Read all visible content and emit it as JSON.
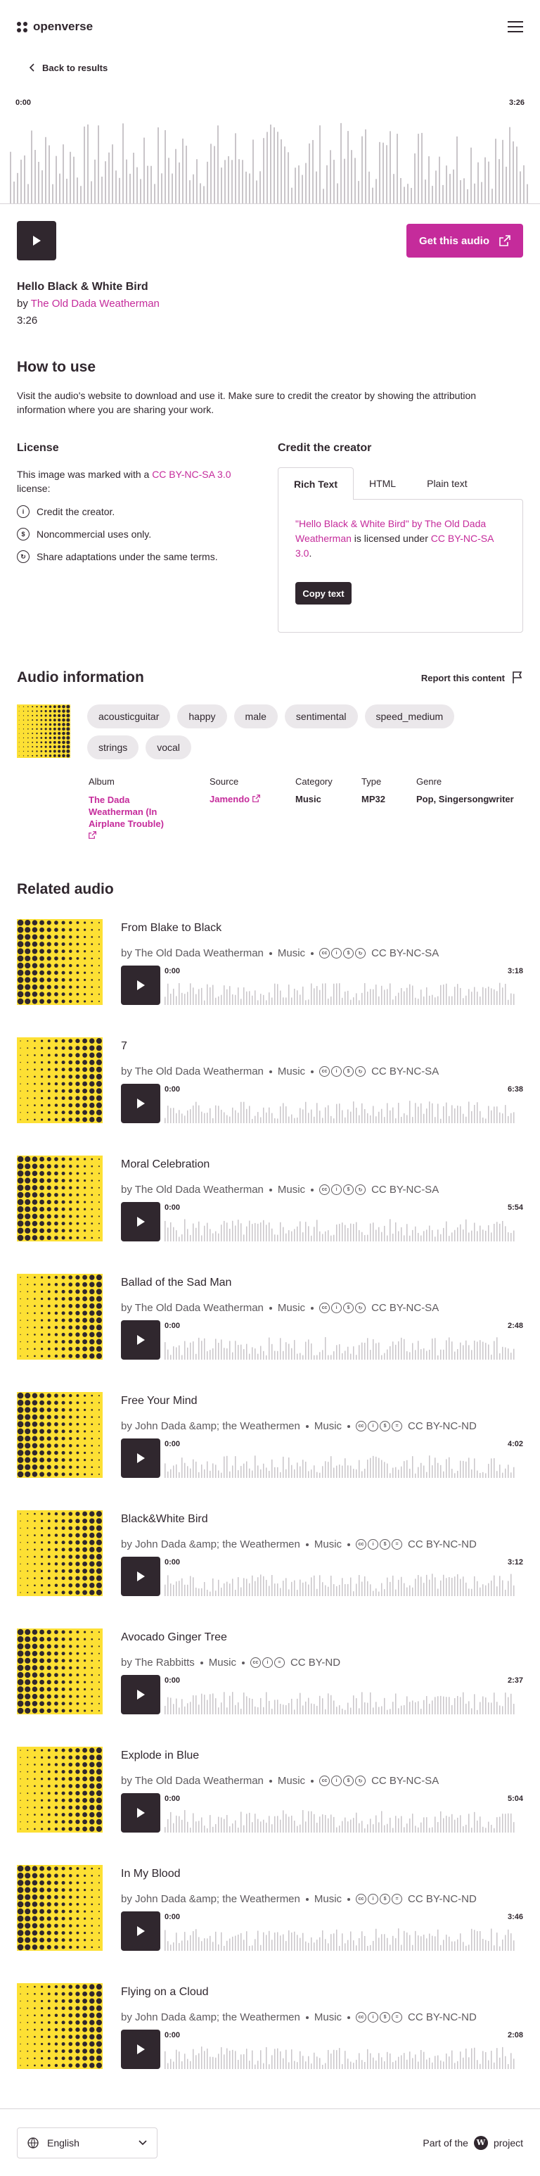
{
  "header": {
    "logo_text": "openverse",
    "menu_icon": "hamburger-icon"
  },
  "back": {
    "label": "Back to results"
  },
  "player": {
    "time_start": "0:00",
    "time_end": "3:26"
  },
  "actions": {
    "get_label": "Get this audio"
  },
  "audio": {
    "title": "Hello Black & White Bird",
    "by_prefix": "by",
    "creator": "The Old Dada Weatherman",
    "duration": "3:26"
  },
  "how": {
    "title": "How to use",
    "text": "Visit the audio's website to download and use it. Make sure to credit the creator by showing the attribution information where you are sharing your work."
  },
  "license": {
    "title": "License",
    "text_before": "This image was marked with a",
    "license_name": "CC BY-NC-SA 3.0",
    "text_after": "license:",
    "items": [
      "Credit the creator.",
      "Noncommercial uses only.",
      "Share adaptations under the same terms."
    ]
  },
  "credit": {
    "title": "Credit the creator",
    "tabs": [
      "Rich Text",
      "HTML",
      "Plain text"
    ],
    "q_open": "\"",
    "work": "Hello Black & White Bird",
    "q_by": "\" by",
    "creator": "The Old Dada Weatherman",
    "licensed": "is licensed under",
    "license": "CC BY-NC-SA 3.0",
    "end": ".",
    "copy_label": "Copy text"
  },
  "info": {
    "title": "Audio information",
    "report_label": "Report this content",
    "tags": [
      "acousticguitar",
      "happy",
      "male",
      "sentimental",
      "speed_medium",
      "strings",
      "vocal"
    ],
    "album_label": "Album",
    "album": "The Dada Weatherman (In Airplane Trouble)",
    "source_label": "Source",
    "source": "Jamendo",
    "category_label": "Category",
    "category": "Music",
    "type_label": "Type",
    "type": "MP32",
    "genre_label": "Genre",
    "genre": "Pop, Singersongwriter"
  },
  "related": {
    "title": "Related audio",
    "items": [
      {
        "title": "From Blake to Black",
        "creator": "by The Old Dada Weatherman",
        "category": "Music",
        "license": "CC BY-NC-SA",
        "start": "0:00",
        "end": "3:18"
      },
      {
        "title": "7",
        "creator": "by The Old Dada Weatherman",
        "category": "Music",
        "license": "CC BY-NC-SA",
        "start": "0:00",
        "end": "6:38"
      },
      {
        "title": "Moral Celebration",
        "creator": "by The Old Dada Weatherman",
        "category": "Music",
        "license": "CC BY-NC-SA",
        "start": "0:00",
        "end": "5:54"
      },
      {
        "title": "Ballad of the Sad Man",
        "creator": "by The Old Dada Weatherman",
        "category": "Music",
        "license": "CC BY-NC-SA",
        "start": "0:00",
        "end": "2:48"
      },
      {
        "title": "Free Your Mind",
        "creator": "by John Dada &amp; the Weathermen",
        "category": "Music",
        "license": "CC BY-NC-ND",
        "start": "0:00",
        "end": "4:02"
      },
      {
        "title": "Black&White Bird",
        "creator": "by John Dada &amp; the Weathermen",
        "category": "Music",
        "license": "CC BY-NC-ND",
        "start": "0:00",
        "end": "3:12"
      },
      {
        "title": "Avocado Ginger Tree",
        "creator": "by The Rabbitts",
        "category": "Music",
        "license": "CC BY-ND",
        "start": "0:00",
        "end": "2:37"
      },
      {
        "title": "Explode in Blue",
        "creator": "by The Old Dada Weatherman",
        "category": "Music",
        "license": "CC BY-NC-SA",
        "start": "0:00",
        "end": "5:04"
      },
      {
        "title": "In My Blood",
        "creator": "by John Dada &amp; the Weathermen",
        "category": "Music",
        "license": "CC BY-NC-ND",
        "start": "0:00",
        "end": "3:46"
      },
      {
        "title": "Flying on a Cloud",
        "creator": "by John Dada &amp; the Weathermen",
        "category": "Music",
        "license": "CC BY-NC-ND",
        "start": "0:00",
        "end": "2:08"
      }
    ]
  },
  "footer": {
    "language": "English",
    "part_of": "Part of the",
    "project": "project"
  },
  "colors": {
    "accent": "#c52b9b",
    "dark": "#30272e",
    "thumb_yellow": "#fde034"
  }
}
